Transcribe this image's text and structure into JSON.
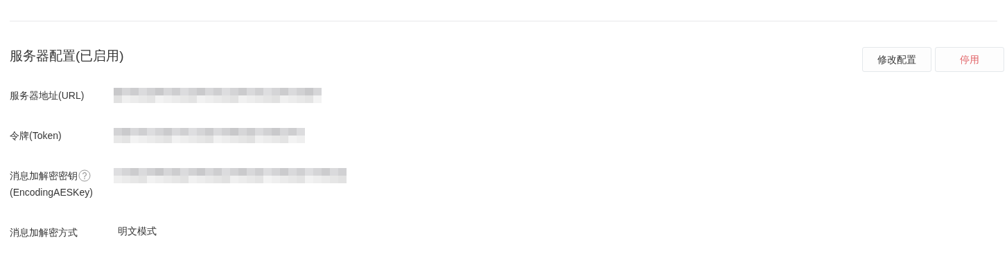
{
  "title": "服务器配置(已启用)",
  "buttons": [
    {
      "label": "修改配置",
      "kind": "default"
    },
    {
      "label": "停用",
      "kind": "danger"
    }
  ],
  "fields": [
    {
      "label": "服务器地址(URL)",
      "help": false,
      "kind": "redacted"
    },
    {
      "label": "令牌(Token)",
      "help": false,
      "kind": "redacted"
    },
    {
      "label": "消息加解密密钥",
      "label_suffix": "(EncodingAESKey)",
      "help": true,
      "kind": "redacted"
    },
    {
      "label": "消息加解密方式",
      "help": false,
      "kind": "text",
      "value": "明文模式"
    }
  ]
}
